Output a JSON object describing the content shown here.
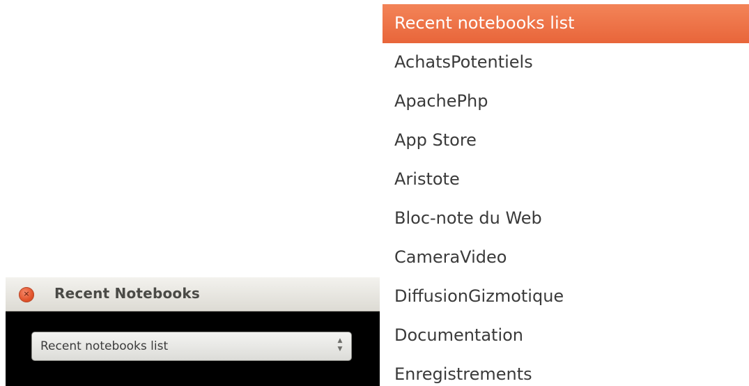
{
  "dialog": {
    "title": "Recent Notebooks",
    "close_icon": "×",
    "combo": {
      "selected_value": "Recent notebooks list",
      "arrows_up": "▲",
      "arrows_down": "▼"
    }
  },
  "dropdown": {
    "header": "Recent notebooks list",
    "items": [
      "AchatsPotentiels",
      "ApachePhp",
      "App Store",
      "Aristote",
      "Bloc-note du Web",
      "CameraVideo",
      "DiffusionGizmotique",
      "Documentation",
      "Enregistrements"
    ]
  },
  "colors": {
    "accent": "#e8653a",
    "close_button": "#e2552d",
    "dialog_body": "#000000"
  }
}
